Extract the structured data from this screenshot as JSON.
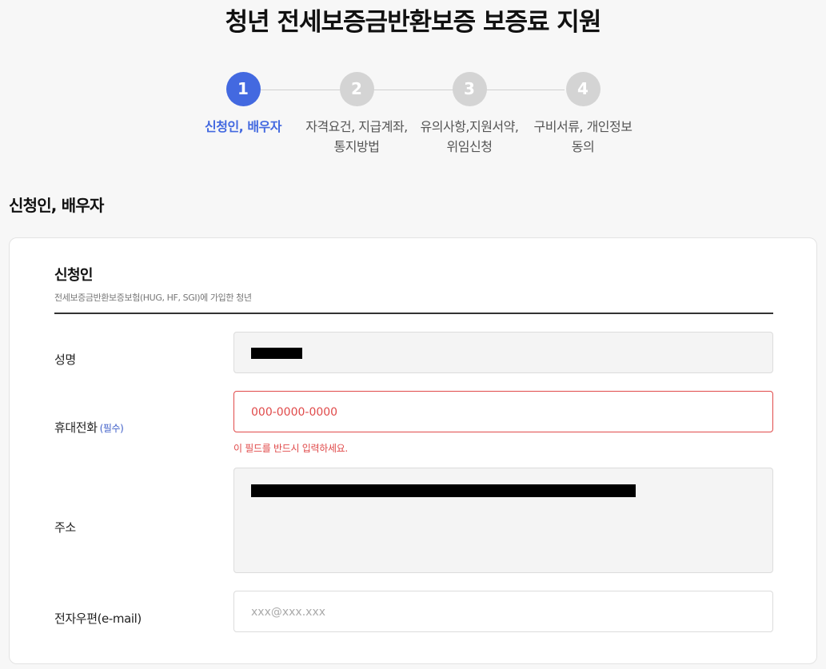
{
  "page": {
    "title": "청년 전세보증금반환보증 보증료 지원",
    "section_title": "신청인, 배우자"
  },
  "stepper": {
    "steps": [
      {
        "number": "1",
        "label_line1": "신청인, 배우자",
        "label_line2": "",
        "state": "active"
      },
      {
        "number": "2",
        "label_line1": "자격요건, 지급계좌,",
        "label_line2": "통지방법",
        "state": "inactive"
      },
      {
        "number": "3",
        "label_line1": "유의사항,지원서약,",
        "label_line2": "위임신청",
        "state": "inactive"
      },
      {
        "number": "4",
        "label_line1": "구비서류, 개인정보",
        "label_line2": "동의",
        "state": "inactive"
      }
    ]
  },
  "form": {
    "title": "신청인",
    "subtitle": "전세보증금반환보증보험(HUG, HF, SGI)에 가입한 청년",
    "name": {
      "label": "성명",
      "value": ""
    },
    "phone": {
      "label": "휴대전화",
      "required": "(필수)",
      "placeholder": "000-0000-0000",
      "error": "이 필드를 반드시 입력하세요."
    },
    "address": {
      "label": "주소",
      "value": ""
    },
    "email": {
      "label": "전자우편(e-mail)",
      "placeholder": "xxx@xxx.xxx"
    }
  },
  "colors": {
    "accent": "#4369e0",
    "error": "#e04a4a",
    "inactive_step": "#d4d4d4"
  }
}
